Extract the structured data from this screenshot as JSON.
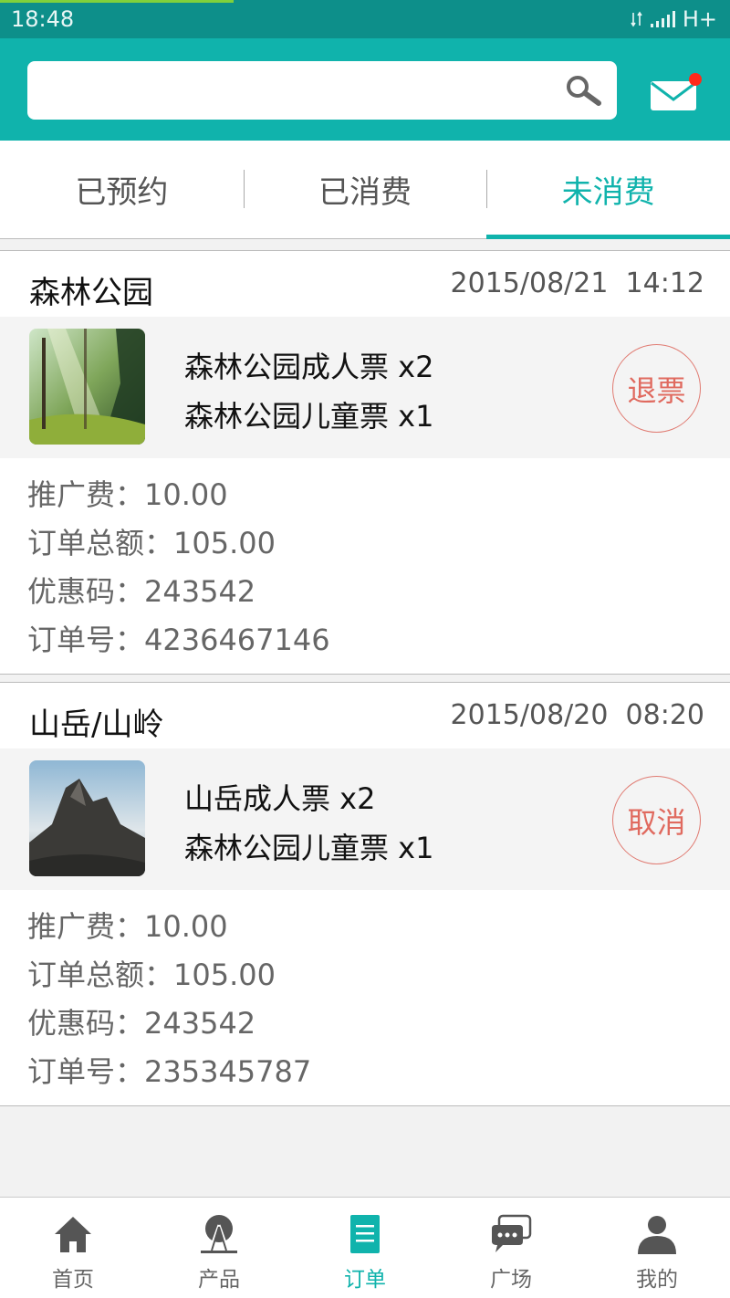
{
  "status_bar": {
    "time": "18:48",
    "network": "H+"
  },
  "search": {
    "value": "",
    "placeholder": ""
  },
  "tabs": [
    {
      "label": "已预约",
      "active": false
    },
    {
      "label": "已消费",
      "active": false
    },
    {
      "label": "未消费",
      "active": true
    }
  ],
  "orders": [
    {
      "name": "森林公园",
      "date": "2015/08/21",
      "time": "14:12",
      "tickets": [
        "森林公园成人票 x2",
        "森林公园儿童票 x1"
      ],
      "action": "退票",
      "promo_fee": "推广费：10.00",
      "total": "订单总额：105.00",
      "coupon": "优惠码：243542",
      "order_no": "订单号：4236467146"
    },
    {
      "name": "山岳/山岭",
      "date": "2015/08/20",
      "time": "08:20",
      "tickets": [
        "山岳成人票 x2",
        "森林公园儿童票 x1"
      ],
      "action": "取消",
      "promo_fee": "推广费：10.00",
      "total": "订单总额：105.00",
      "coupon": "优惠码：243542",
      "order_no": "订单号：235345787"
    }
  ],
  "nav": [
    {
      "label": "首页",
      "icon": "home-icon",
      "active": false
    },
    {
      "label": "产品",
      "icon": "product-icon",
      "active": false
    },
    {
      "label": "订单",
      "icon": "order-icon",
      "active": true
    },
    {
      "label": "广场",
      "icon": "chat-icon",
      "active": false
    },
    {
      "label": "我的",
      "icon": "user-icon",
      "active": false
    }
  ],
  "colors": {
    "accent": "#10b3ac",
    "status_bar": "#0d8f8a",
    "action_red": "#e06a5f",
    "notify_dot": "#ff2a1a"
  }
}
